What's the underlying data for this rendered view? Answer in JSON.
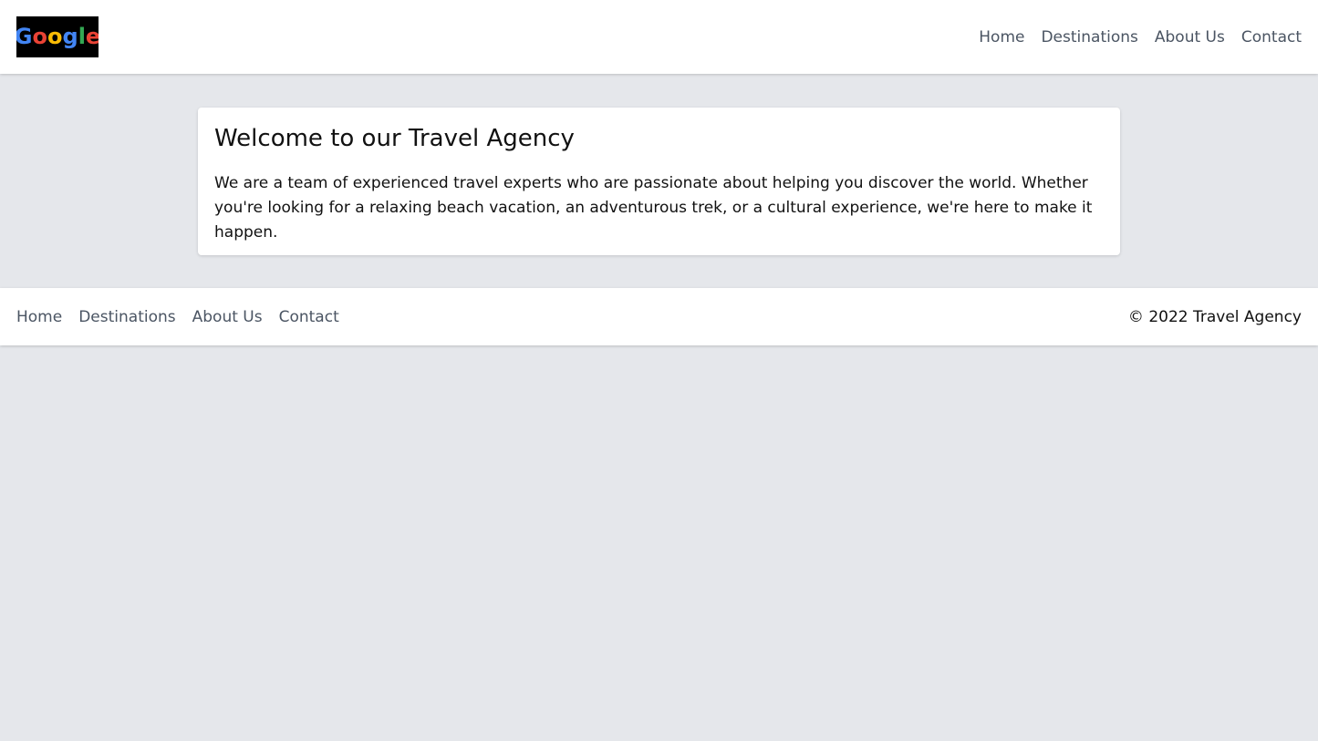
{
  "header": {
    "logo_text": "Google",
    "nav": [
      {
        "label": "Home"
      },
      {
        "label": "Destinations"
      },
      {
        "label": "About Us"
      },
      {
        "label": "Contact"
      }
    ]
  },
  "main": {
    "title": "Welcome to our Travel Agency",
    "description": "We are a team of experienced travel experts who are passionate about helping you discover the world. Whether you're looking for a relaxing beach vacation, an adventurous trek, or a cultural experience, we're here to make it happen."
  },
  "footer": {
    "nav": [
      {
        "label": "Home"
      },
      {
        "label": "Destinations"
      },
      {
        "label": "About Us"
      },
      {
        "label": "Contact"
      }
    ],
    "copyright": "© 2022 Travel Agency"
  },
  "colors": {
    "page_background": "#e5e7eb",
    "surface": "#ffffff",
    "nav_text": "#4b5563",
    "body_text": "#111111"
  }
}
